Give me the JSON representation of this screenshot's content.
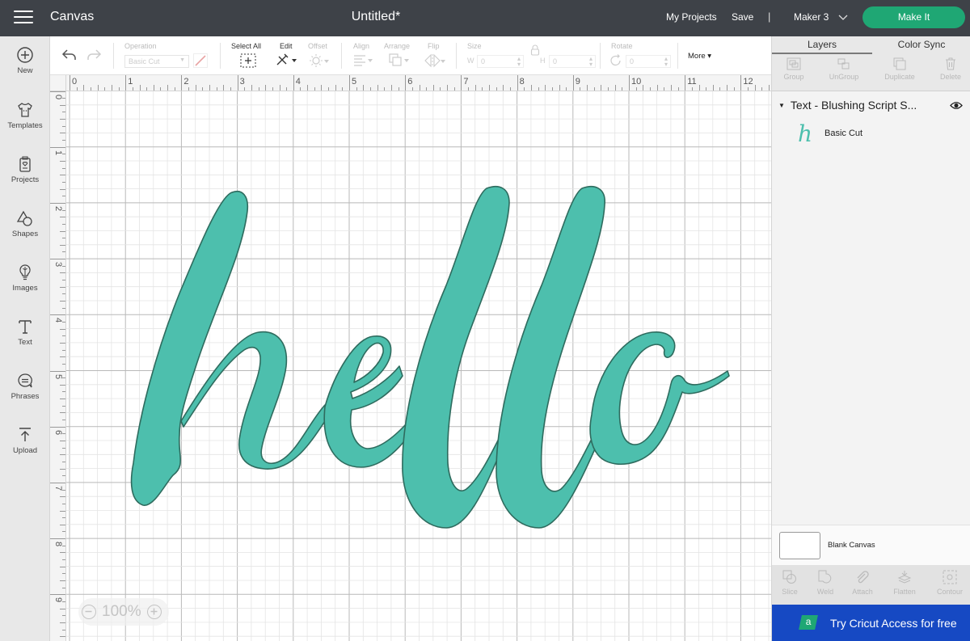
{
  "topbar": {
    "menu_icon": "hamburger-menu-icon",
    "app_title": "Canvas",
    "document_title": "Untitled*",
    "my_projects_label": "My Projects",
    "save_label": "Save",
    "separator": "|",
    "machine_label": "Maker 3",
    "make_it_label": "Make It",
    "make_it_color": "#1fa774"
  },
  "leftbar": {
    "items": [
      {
        "label": "New",
        "icon": "plus-circle-icon"
      },
      {
        "label": "Templates",
        "icon": "tshirt-icon"
      },
      {
        "label": "Projects",
        "icon": "project-icon"
      },
      {
        "label": "Shapes",
        "icon": "shapes-icon"
      },
      {
        "label": "Images",
        "icon": "lightbulb-icon"
      },
      {
        "label": "Text",
        "icon": "text-icon"
      },
      {
        "label": "Phrases",
        "icon": "speech-bubble-icon"
      },
      {
        "label": "Upload",
        "icon": "upload-icon"
      }
    ]
  },
  "toolbar": {
    "operation_label": "Operation",
    "operation_value": "Basic Cut",
    "select_all_label": "Select All",
    "edit_label": "Edit",
    "offset_label": "Offset",
    "align_label": "Align",
    "arrange_label": "Arrange",
    "flip_label": "Flip",
    "size_label": "Size",
    "width_prefix": "W",
    "width_value": "0",
    "height_prefix": "H",
    "height_value": "0",
    "rotate_label": "Rotate",
    "rotate_value": "0",
    "more_label": "More ▾"
  },
  "canvas": {
    "ruler_h_labels": [
      "0",
      "1",
      "2",
      "3",
      "4",
      "5",
      "6",
      "7",
      "8",
      "9",
      "10",
      "11",
      "12"
    ],
    "ruler_v_labels": [
      "0",
      "1",
      "2",
      "3",
      "4",
      "5",
      "6",
      "7",
      "8",
      "9"
    ],
    "zoom_level": "100%",
    "text_object": {
      "text": "hello",
      "fill_color": "#4dbfad",
      "stroke_color": "#2e6b5e"
    }
  },
  "rightpanel": {
    "tabs": [
      {
        "label": "Layers",
        "active": true
      },
      {
        "label": "Color Sync",
        "active": false
      }
    ],
    "tools": [
      {
        "label": "Group",
        "icon": "group-icon"
      },
      {
        "label": "UnGroup",
        "icon": "ungroup-icon"
      },
      {
        "label": "Duplicate",
        "icon": "duplicate-icon"
      },
      {
        "label": "Delete",
        "icon": "trash-icon"
      }
    ],
    "layer": {
      "title": "Text - Blushing Script S...",
      "thumb_glyph": "h",
      "operation": "Basic Cut"
    },
    "blank_canvas_label": "Blank Canvas",
    "bottom_tools": [
      {
        "label": "Slice",
        "icon": "slice-icon"
      },
      {
        "label": "Weld",
        "icon": "weld-icon"
      },
      {
        "label": "Attach",
        "icon": "paperclip-icon"
      },
      {
        "label": "Flatten",
        "icon": "flatten-icon"
      },
      {
        "label": "Contour",
        "icon": "contour-icon"
      }
    ],
    "promo": {
      "badge": "a",
      "text": "Try Cricut Access for free"
    }
  }
}
